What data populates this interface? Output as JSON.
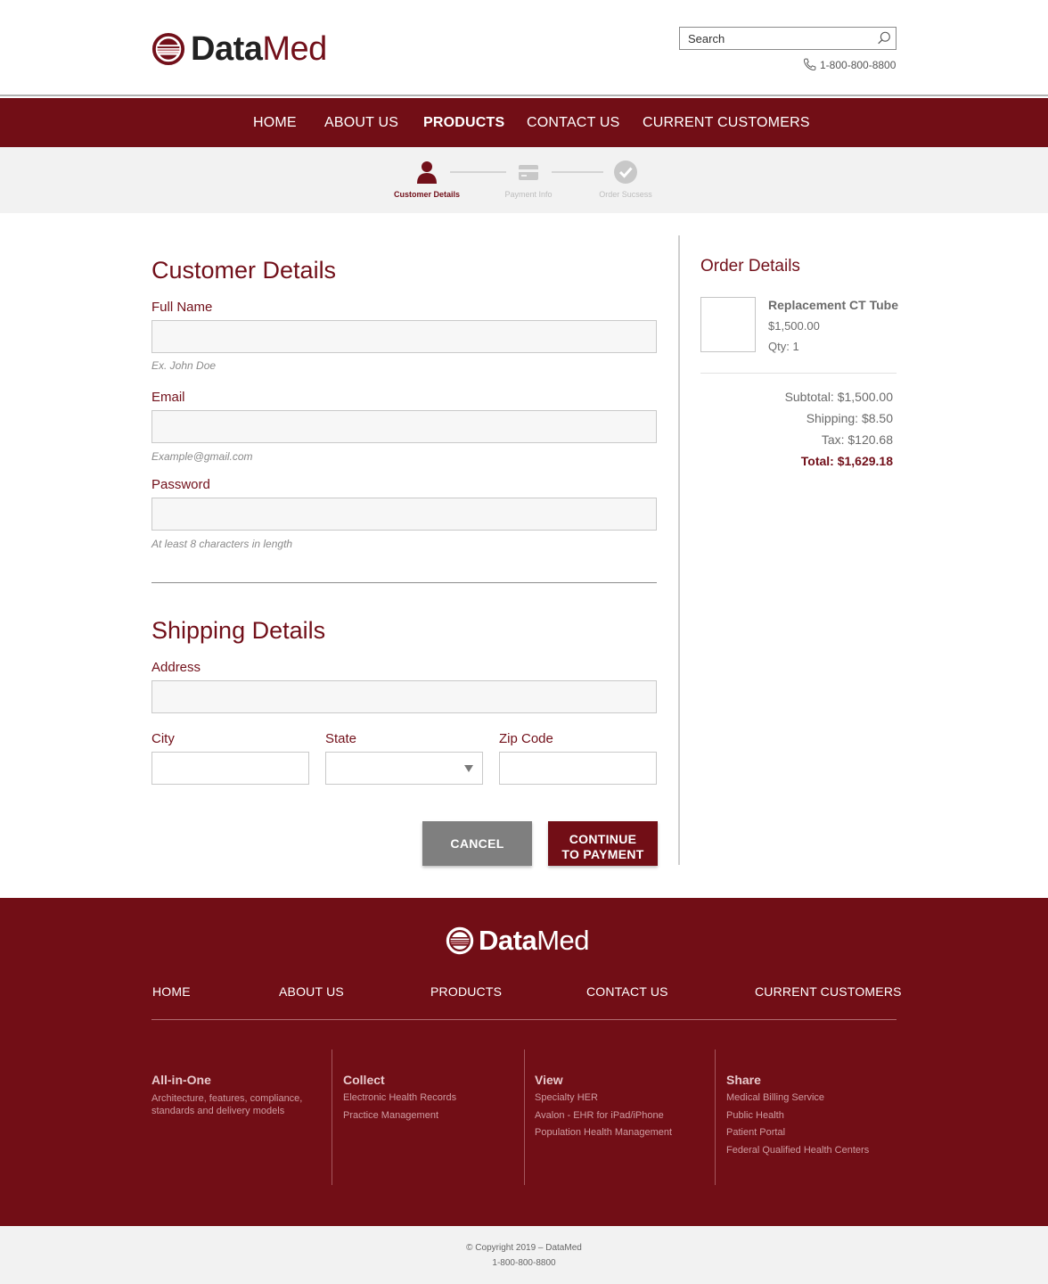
{
  "brand": {
    "name_bold": "Data",
    "name_light": "Med",
    "primary_color": "#720e16"
  },
  "header": {
    "search_placeholder": "Search",
    "phone": "1-800-800-8800"
  },
  "nav": {
    "items": [
      {
        "label": "HOME"
      },
      {
        "label": "ABOUT US"
      },
      {
        "label": "PRODUCTS",
        "active": true
      },
      {
        "label": "CONTACT US"
      },
      {
        "label": "CURRENT CUSTOMERS"
      }
    ]
  },
  "steps": [
    {
      "label": "Customer Details",
      "icon": "person-icon",
      "state": "active"
    },
    {
      "label": "Payment Info",
      "icon": "credit-card-icon",
      "state": "inactive"
    },
    {
      "label": "Order Sucsess",
      "icon": "check-circle-icon",
      "state": "inactive"
    }
  ],
  "customer": {
    "title": "Customer Details",
    "full_name": {
      "label": "Full Name",
      "value": "",
      "hint": "Ex. John Doe"
    },
    "email": {
      "label": "Email",
      "value": "",
      "hint": "Example@gmail.com"
    },
    "password": {
      "label": "Password",
      "value": "",
      "hint": "At least 8 characters in length"
    }
  },
  "shipping": {
    "title": "Shipping Details",
    "address": {
      "label": "Address",
      "value": ""
    },
    "city": {
      "label": "City",
      "value": ""
    },
    "state": {
      "label": "State",
      "value": ""
    },
    "zip": {
      "label": "Zip Code",
      "value": ""
    }
  },
  "buttons": {
    "cancel": "CANCEL",
    "continue_line1": "CONTINUE",
    "continue_line2": "TO PAYMENT"
  },
  "order": {
    "title": "Order Details",
    "item": {
      "name": "Replacement CT Tube",
      "price": "$1,500.00",
      "qty": "Qty: 1"
    },
    "subtotal": "Subtotal: $1,500.00",
    "shipping": "Shipping: $8.50",
    "tax": "Tax: $120.68",
    "total": "Total: $1,629.18"
  },
  "footer": {
    "nav": [
      "HOME",
      "ABOUT US",
      "PRODUCTS",
      "CONTACT US",
      "CURRENT CUSTOMERS"
    ],
    "columns": [
      {
        "title": "All-in-One",
        "text_line1": "Architecture, features, compliance,",
        "text_line2": "standards and delivery models"
      },
      {
        "title": "Collect",
        "links": [
          "Electronic Health Records",
          "Practice Management"
        ]
      },
      {
        "title": "View",
        "links": [
          "Specialty HER",
          "Avalon - EHR for iPad/iPhone",
          "Population Health Management"
        ]
      },
      {
        "title": "Share",
        "links": [
          "Medical Billing Service",
          "Public Health",
          "Patient Portal",
          "Federal Qualified Health Centers"
        ]
      }
    ],
    "copyright": "© Copyright 2019 – DataMed",
    "phone": "1-800-800-8800"
  }
}
